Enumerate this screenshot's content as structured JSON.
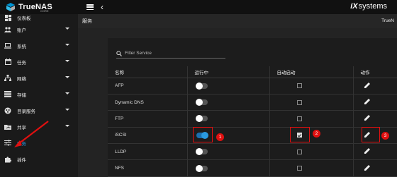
{
  "header": {
    "logo_text": "TrueNAS",
    "logo_sub": "CORE",
    "brand_text": "systems",
    "brand_mark": "iX"
  },
  "sidebar": {
    "items": [
      {
        "label": "仪表板",
        "icon": "dashboard-icon",
        "has_caret": false
      },
      {
        "label": "账户",
        "icon": "people-icon",
        "has_caret": true
      },
      {
        "label": "系统",
        "icon": "laptop-icon",
        "has_caret": true
      },
      {
        "label": "任务",
        "icon": "calendar-icon",
        "has_caret": true
      },
      {
        "label": "网络",
        "icon": "network-icon",
        "has_caret": true
      },
      {
        "label": "存储",
        "icon": "storage-icon",
        "has_caret": true
      },
      {
        "label": "目录服务",
        "icon": "directory-icon",
        "has_caret": true
      },
      {
        "label": "共享",
        "icon": "folder-share-icon",
        "has_caret": true
      },
      {
        "label": "服务",
        "icon": "tune-icon",
        "has_caret": false,
        "active": true
      },
      {
        "label": "插件",
        "icon": "puzzle-icon",
        "has_caret": false
      }
    ]
  },
  "page": {
    "title": "服务",
    "right_text": "TrueN"
  },
  "search": {
    "placeholder": "Filter Service"
  },
  "table": {
    "columns": [
      "名称",
      "运行中",
      "自动启动",
      "动作"
    ],
    "rows": [
      {
        "name": "AFP",
        "running": false,
        "autostart": false
      },
      {
        "name": "Dynamic DNS",
        "running": false,
        "autostart": false
      },
      {
        "name": "FTP",
        "running": false,
        "autostart": false
      },
      {
        "name": "iSCSI",
        "running": true,
        "autostart": true
      },
      {
        "name": "LLDP",
        "running": false,
        "autostart": false
      },
      {
        "name": "NFS",
        "running": false,
        "autostart": false
      }
    ]
  },
  "annotations": {
    "badges": [
      "1",
      "2",
      "3"
    ],
    "color": "#e01010"
  },
  "colors": {
    "accent": "#2a9ae0",
    "topbar": "#111111",
    "sidebar": "#1a1a1a"
  }
}
